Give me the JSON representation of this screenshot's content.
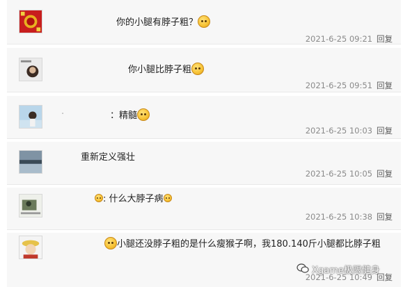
{
  "comments": [
    {
      "avatar_icon": "festive-red-avatar-icon",
      "text": "你的小腿有脖子粗？",
      "emoji": "sweating-face-emoji",
      "date": "2021-6-25 09:21",
      "reply": "回复"
    },
    {
      "avatar_icon": "portrait-photo-avatar-icon",
      "text": "你小腿比脖子粗",
      "emoji": "grinning-face-emoji",
      "date": "2021-6-25 09:51",
      "reply": "回复"
    },
    {
      "avatar_icon": "sky-woman-avatar-icon",
      "prefix": "·",
      "text": "：精髓",
      "emoji": "laughing-face-emoji",
      "date": "2021-6-25 10:03",
      "reply": "回复"
    },
    {
      "avatar_icon": "landscape-avatar-icon",
      "text": "重新定义强壮",
      "date": "2021-6-25 10:05",
      "reply": "回复"
    },
    {
      "avatar_icon": "cartoon-avatar-icon",
      "prefix_emoji": "small-emoji",
      "text": ": 什么大脖子病",
      "emoji": "small-smile-emoji",
      "date": "2021-6-25 10:38",
      "reply": "回复"
    },
    {
      "avatar_icon": "anime-avatar-icon",
      "emoji": "sweating-face-emoji",
      "text": "小腿还没脖子粗的是什么瘦猴子啊，我180.140斤小腿都比脖子粗",
      "date": "2021-6-25 10:49",
      "reply": "回复"
    }
  ],
  "watermark": {
    "text": "Xgame极限健身",
    "icon": "wechat-logo-icon"
  }
}
